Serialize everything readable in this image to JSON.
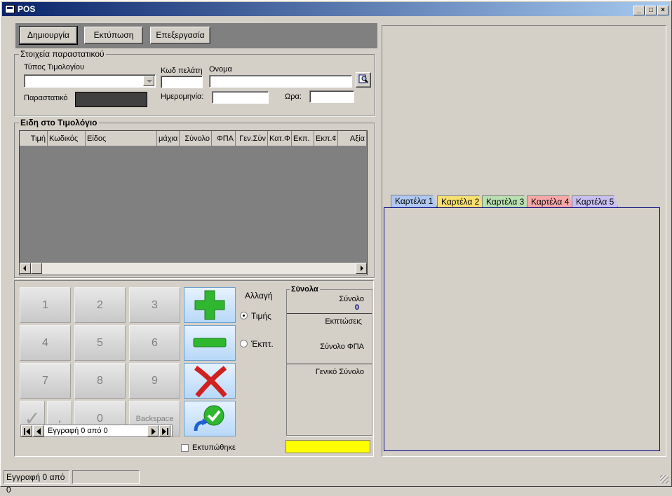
{
  "window": {
    "title": "POS",
    "min_label": "_",
    "max_label": "□",
    "close_label": "×"
  },
  "toolbar": {
    "create_label": "Δημιουργία",
    "print_label": "Εκτύπωση",
    "edit_label": "Επεξεργασία"
  },
  "document": {
    "group_title": "Στοιχεία παραστατικού",
    "invoice_type_label": "Τύπος Τιμολογίου",
    "invoice_type_value": "",
    "customer_code_label": "Κωδ πελάτη",
    "customer_code_value": "",
    "name_label": "Ονομα",
    "name_value": "",
    "doc_label": "Παραστατικό",
    "date_label": "Ημερομηνία:",
    "date_value": "",
    "time_label": "Ωρα:",
    "time_value": ""
  },
  "items": {
    "group_title": "Ειδη στο Τιμολόγιο",
    "columns": [
      "Τιμή",
      "Κωδικός",
      "Είδος",
      "μάχια",
      "Σύνολο",
      "ΦΠΑ",
      "Γεν.Σύν",
      "Κατ.Φ",
      "Εκπ.",
      "Εκπ.¢",
      "Αξία"
    ]
  },
  "keypad": {
    "keys": [
      "1",
      "2",
      "3",
      "4",
      "5",
      "6",
      "7",
      "8",
      "9",
      ",",
      "0",
      "Backspace"
    ],
    "check_label": "✓"
  },
  "change": {
    "label": "Αλλαγή",
    "price_label": "Τιμής",
    "discount_label": "Έκπτ.",
    "selected": "price"
  },
  "totals": {
    "group_title": "Σύνολα",
    "total_label": "Σύνολο",
    "total_value": "0",
    "discounts_label": "Εκπτώσεις",
    "vat_total_label": "Σύνολο ΦΠΑ",
    "grand_total_label": "Γενικό Σύνολο"
  },
  "nav": {
    "record_text": "Εγγραφή 0 από 0",
    "printed_label": "Εκτυπώθηκε"
  },
  "tabs": [
    {
      "label": "Καρτέλα 1",
      "color": "#b0c8f0"
    },
    {
      "label": "Καρτέλα 2",
      "color": "#f8e070"
    },
    {
      "label": "Καρτέλα 3",
      "color": "#b8e0b0"
    },
    {
      "label": "Καρτέλα 4",
      "color": "#f8a8a8"
    },
    {
      "label": "Καρτέλα 5",
      "color": "#c8c0f0"
    }
  ],
  "status": {
    "record_text": "Εγγραφή 0 από 0"
  },
  "colors": {
    "title_start": "#0a246a",
    "total_value": "#000080",
    "highlight_field": "#ffff00"
  }
}
